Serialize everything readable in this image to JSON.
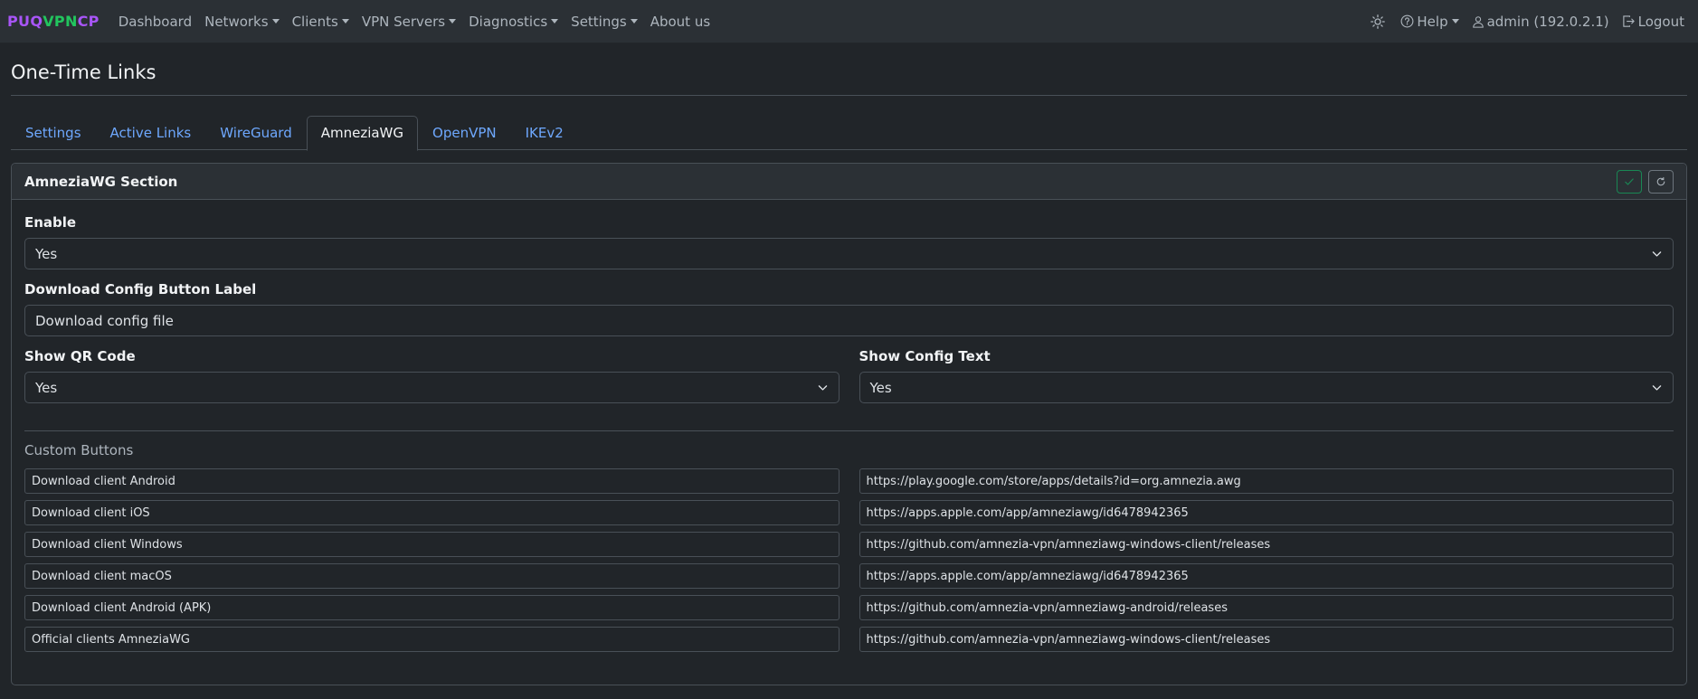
{
  "navbar": {
    "brand": {
      "part1": "PUQ",
      "part2": "VPN",
      "part3": "CP"
    },
    "items": [
      {
        "label": "Dashboard",
        "dropdown": false
      },
      {
        "label": "Networks",
        "dropdown": true
      },
      {
        "label": "Clients",
        "dropdown": true
      },
      {
        "label": "VPN Servers",
        "dropdown": true
      },
      {
        "label": "Diagnostics",
        "dropdown": true
      },
      {
        "label": "Settings",
        "dropdown": true
      },
      {
        "label": "About us",
        "dropdown": false
      }
    ],
    "right": {
      "theme_icon": "sun-icon",
      "help_label": "Help",
      "user_label": "admin (192.0.2.1)",
      "logout_label": "Logout"
    }
  },
  "page": {
    "title": "One-Time Links"
  },
  "tabs": [
    {
      "label": "Settings",
      "active": false
    },
    {
      "label": "Active Links",
      "active": false
    },
    {
      "label": "WireGuard",
      "active": false
    },
    {
      "label": "AmneziaWG",
      "active": true
    },
    {
      "label": "OpenVPN",
      "active": false
    },
    {
      "label": "IKEv2",
      "active": false
    }
  ],
  "card": {
    "title": "AmneziaWG Section",
    "enable": {
      "label": "Enable",
      "value": "Yes"
    },
    "download_label": {
      "label": "Download Config Button Label",
      "value": "Download config file"
    },
    "show_qr": {
      "label": "Show QR Code",
      "value": "Yes"
    },
    "show_config": {
      "label": "Show Config Text",
      "value": "Yes"
    },
    "custom_buttons": {
      "title": "Custom Buttons",
      "rows": [
        {
          "label": "Download client Android",
          "url": "https://play.google.com/store/apps/details?id=org.amnezia.awg"
        },
        {
          "label": "Download client iOS",
          "url": "https://apps.apple.com/app/amneziawg/id6478942365"
        },
        {
          "label": "Download client Windows",
          "url": "https://github.com/amnezia-vpn/amneziawg-windows-client/releases"
        },
        {
          "label": "Download client macOS",
          "url": "https://apps.apple.com/app/amneziawg/id6478942365"
        },
        {
          "label": "Download client Android (APK)",
          "url": "https://github.com/amnezia-vpn/amneziawg-android/releases"
        },
        {
          "label": "Official clients AmneziaWG",
          "url": "https://github.com/amnezia-vpn/amneziawg-windows-client/releases"
        }
      ]
    }
  },
  "colors": {
    "accent_link": "#6ea8fe",
    "brand_purple": "#a855f7",
    "brand_green": "#22c55e",
    "save_green": "#198754"
  }
}
